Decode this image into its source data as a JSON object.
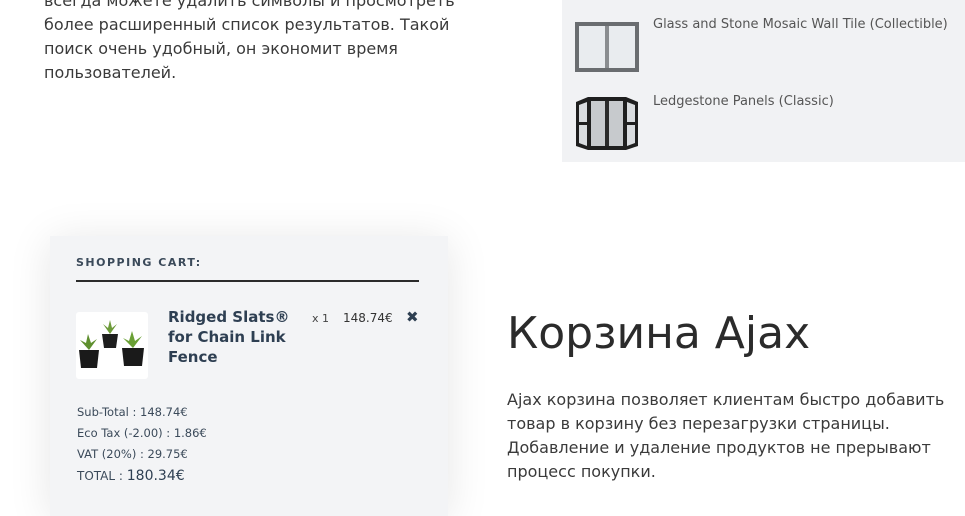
{
  "search_text": {
    "lines": [
      "всегда можете удалить символы и просмотреть",
      "более расширенный список результатов. Такой",
      "поиск очень удобный, он экономит время",
      "пользователей."
    ]
  },
  "products": [
    {
      "name": "Glass and Stone Mosaic Wall Tile (Collectible)",
      "icon": "window-thumbnail-icon"
    },
    {
      "name": "Ledgestone Panels (Classic)",
      "icon": "bay-window-thumbnail-icon"
    }
  ],
  "cart": {
    "heading": "SHOPPING CART:",
    "item": {
      "name": "Ridged Slats® for Chain Link Fence",
      "qty": "x 1",
      "price": "148.74€",
      "remove": "✖",
      "icon": "succulent-plants-thumbnail-icon"
    },
    "subtotal": "Sub-Total : 148.74€",
    "eco_tax": "Eco Tax (-2.00) : 1.86€",
    "vat": "VAT (20%) : 29.75€",
    "total_label": "TOTAL : ",
    "total_value": "180.34€"
  },
  "ajax_cart": {
    "title": "Корзина Ajax",
    "lines": [
      "Ajax корзина позволяет клиентам быстро добавить",
      "товар в корзину без перезагрузки страницы.",
      "Добавление и удаление продуктов не прерывают",
      "процесс покупки."
    ]
  },
  "colors": {
    "accent": "#2e3f52",
    "panel": "#f1f2f4",
    "card": "#f3f4f6"
  }
}
